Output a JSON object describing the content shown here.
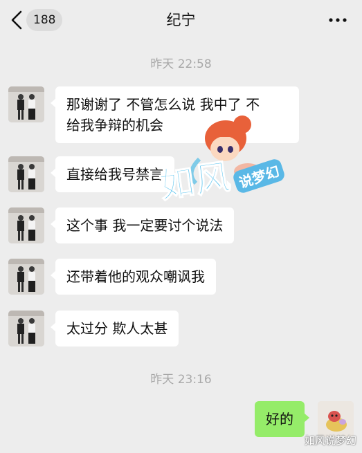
{
  "header": {
    "title": "纪宁",
    "unread_count": "188",
    "back_icon": "chevron-left-icon",
    "more_icon": "more-horizontal-icon"
  },
  "timestamps": [
    "昨天 22:58",
    "昨天 23:16"
  ],
  "messages_incoming": [
    {
      "lines": [
        "那谢谢了  不管怎么说  我中了  不",
        "给我争辩的机会"
      ]
    },
    {
      "lines": [
        "直接给我号禁言"
      ]
    },
    {
      "lines": [
        "这个事  我一定要讨个说法"
      ]
    },
    {
      "lines": [
        "还带着他的观众嘲讽我"
      ]
    },
    {
      "lines": [
        "太过分  欺人太甚"
      ]
    }
  ],
  "message_outgoing": {
    "text": "好的"
  },
  "watermark": {
    "main": "如风",
    "sub": "说梦幻"
  },
  "corner_watermark": "如风说梦幻",
  "colors": {
    "background": "#ededed",
    "incoming_bubble": "#ffffff",
    "outgoing_bubble": "#95ec69",
    "timestamp_text": "#a8a8a8"
  }
}
